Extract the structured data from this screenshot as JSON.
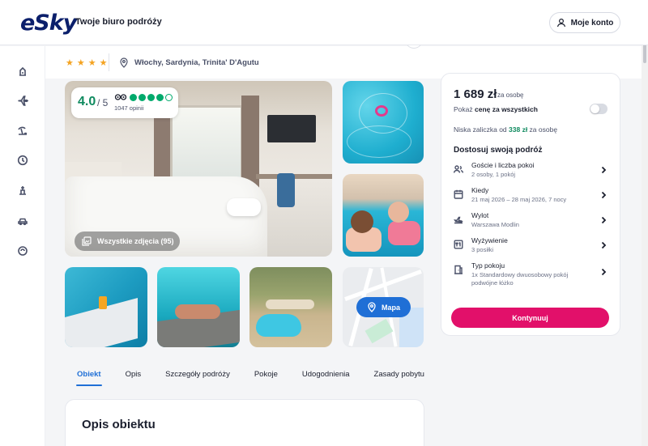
{
  "header": {
    "logo_text": "eSky",
    "tagline": "Twoje biuro podróży",
    "account_label": "Moje konto"
  },
  "sidebar": {
    "items": [
      {
        "icon": "hotel-icon"
      },
      {
        "icon": "plane-icon"
      },
      {
        "icon": "beach-icon"
      },
      {
        "icon": "clock-icon"
      },
      {
        "icon": "holiday-icon"
      },
      {
        "icon": "car-icon"
      },
      {
        "icon": "sun-icon"
      }
    ]
  },
  "hotel": {
    "stars": [
      "★",
      "★",
      "★",
      "★"
    ],
    "location": "Włochy, Sardynia, Trinita' D'Agutu"
  },
  "gallery": {
    "rating_value": "4.0",
    "rating_of": "/ 5",
    "rating_dots": 4,
    "rating_dots_total": 5,
    "reviews": "1047 opinii",
    "all_photos_label": "Wszystkie zdjęcia (95)",
    "map_label": "Mapa"
  },
  "tabs": [
    {
      "label": "Obiekt",
      "active": true
    },
    {
      "label": "Opis"
    },
    {
      "label": "Szczegóły podróży"
    },
    {
      "label": "Pokoje"
    },
    {
      "label": "Udogodnienia"
    },
    {
      "label": "Zasady pobytu"
    }
  ],
  "description": {
    "title": "Opis obiektu"
  },
  "booking": {
    "price": "1 689 zł",
    "per_person": "za osobę",
    "show_all_prefix": "Pokaż ",
    "show_all_bold": "cenę za wszystkich",
    "deposit_prefix": "Niska zaliczka od ",
    "deposit_amount": "338 zł",
    "deposit_suffix": " za osobę",
    "customize_title": "Dostosuj swoją podróż",
    "rows": [
      {
        "label": "Goście i liczba pokoi",
        "value": "2 osoby, 1 pokój",
        "icon": "guests-icon"
      },
      {
        "label": "Kiedy",
        "value": "21 maj 2026 – 28 maj 2026, 7 nocy",
        "icon": "calendar-icon"
      },
      {
        "label": "Wylot",
        "value": "Warszawa Modlin",
        "icon": "departure-icon"
      },
      {
        "label": "Wyżywienie",
        "value": "3 posiłki",
        "icon": "meal-icon"
      },
      {
        "label": "Typ pokoju",
        "value": "1x Standardowy dwuosobowy pokój podwójne łóżko",
        "icon": "room-icon"
      }
    ],
    "cta_label": "Kontynuuj"
  },
  "colors": {
    "accent": "#1f6fd6",
    "cta": "#e2106a",
    "rating_green": "#00aa6c",
    "star": "#f4a321"
  }
}
